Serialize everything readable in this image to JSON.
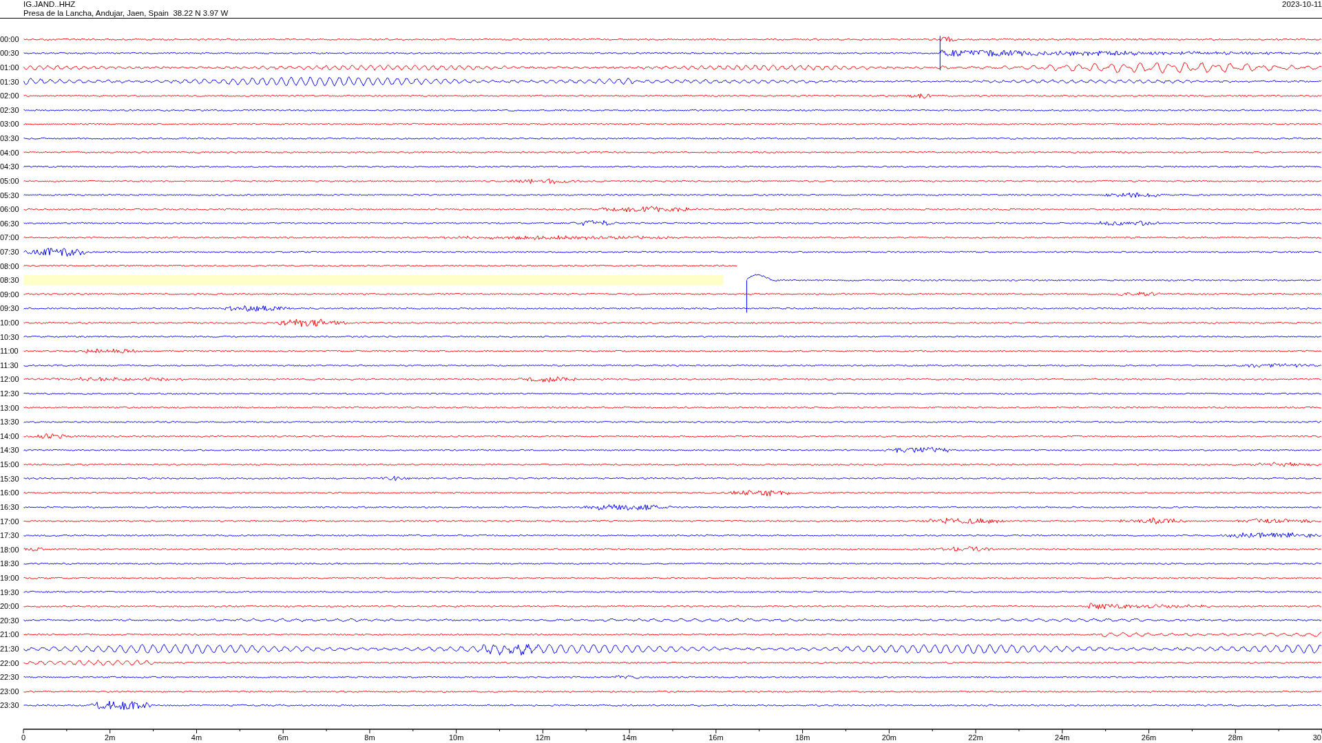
{
  "header": {
    "station": "IG.JAND..HHZ",
    "location": "Presa de la Lancha, Andujar, Jaen, Spain  38.22 N 3.97 W",
    "date": "2023-10-11"
  },
  "rows": [
    {
      "time": "00:00",
      "color": "#ff0000"
    },
    {
      "time": "00:30",
      "color": "#0000ff"
    },
    {
      "time": "01:00",
      "color": "#ff0000"
    },
    {
      "time": "01:30",
      "color": "#0000ff"
    },
    {
      "time": "02:00",
      "color": "#ff0000"
    },
    {
      "time": "02:30",
      "color": "#0000ff"
    },
    {
      "time": "03:00",
      "color": "#ff0000"
    },
    {
      "time": "03:30",
      "color": "#0000ff"
    },
    {
      "time": "04:00",
      "color": "#ff0000"
    },
    {
      "time": "04:30",
      "color": "#0000ff"
    },
    {
      "time": "05:00",
      "color": "#ff0000"
    },
    {
      "time": "05:30",
      "color": "#0000ff"
    },
    {
      "time": "06:00",
      "color": "#ff0000"
    },
    {
      "time": "06:30",
      "color": "#0000ff"
    },
    {
      "time": "07:00",
      "color": "#ff0000"
    },
    {
      "time": "07:30",
      "color": "#0000ff"
    },
    {
      "time": "08:00",
      "color": "#ff0000"
    },
    {
      "time": "08:30",
      "color": "#0000ff",
      "gap": true
    },
    {
      "time": "09:00",
      "color": "#ff0000"
    },
    {
      "time": "09:30",
      "color": "#0000ff"
    },
    {
      "time": "10:00",
      "color": "#ff0000"
    },
    {
      "time": "10:30",
      "color": "#0000ff"
    },
    {
      "time": "11:00",
      "color": "#ff0000"
    },
    {
      "time": "11:30",
      "color": "#0000ff"
    },
    {
      "time": "12:00",
      "color": "#ff0000"
    },
    {
      "time": "12:30",
      "color": "#0000ff"
    },
    {
      "time": "13:00",
      "color": "#ff0000"
    },
    {
      "time": "13:30",
      "color": "#0000ff"
    },
    {
      "time": "14:00",
      "color": "#ff0000"
    },
    {
      "time": "14:30",
      "color": "#0000ff"
    },
    {
      "time": "15:00",
      "color": "#ff0000"
    },
    {
      "time": "15:30",
      "color": "#0000ff"
    },
    {
      "time": "16:00",
      "color": "#ff0000"
    },
    {
      "time": "16:30",
      "color": "#0000ff"
    },
    {
      "time": "17:00",
      "color": "#ff0000"
    },
    {
      "time": "17:30",
      "color": "#0000ff"
    },
    {
      "time": "18:00",
      "color": "#ff0000"
    },
    {
      "time": "18:30",
      "color": "#0000ff"
    },
    {
      "time": "19:00",
      "color": "#ff0000"
    },
    {
      "time": "19:30",
      "color": "#0000ff"
    },
    {
      "time": "20:00",
      "color": "#ff0000"
    },
    {
      "time": "20:30",
      "color": "#0000ff"
    },
    {
      "time": "21:00",
      "color": "#ff0000"
    },
    {
      "time": "21:30",
      "color": "#0000ff"
    },
    {
      "time": "22:00",
      "color": "#ff0000"
    },
    {
      "time": "22:30",
      "color": "#0000ff"
    },
    {
      "time": "23:00",
      "color": "#ff0000"
    },
    {
      "time": "23:30",
      "color": "#0000ff"
    }
  ],
  "axis": {
    "labels": [
      "0",
      "2m",
      "4m",
      "6m",
      "8m",
      "10m",
      "12m",
      "14m",
      "16m",
      "18m",
      "20m",
      "22m",
      "24m",
      "26m",
      "28m",
      "30"
    ]
  }
}
